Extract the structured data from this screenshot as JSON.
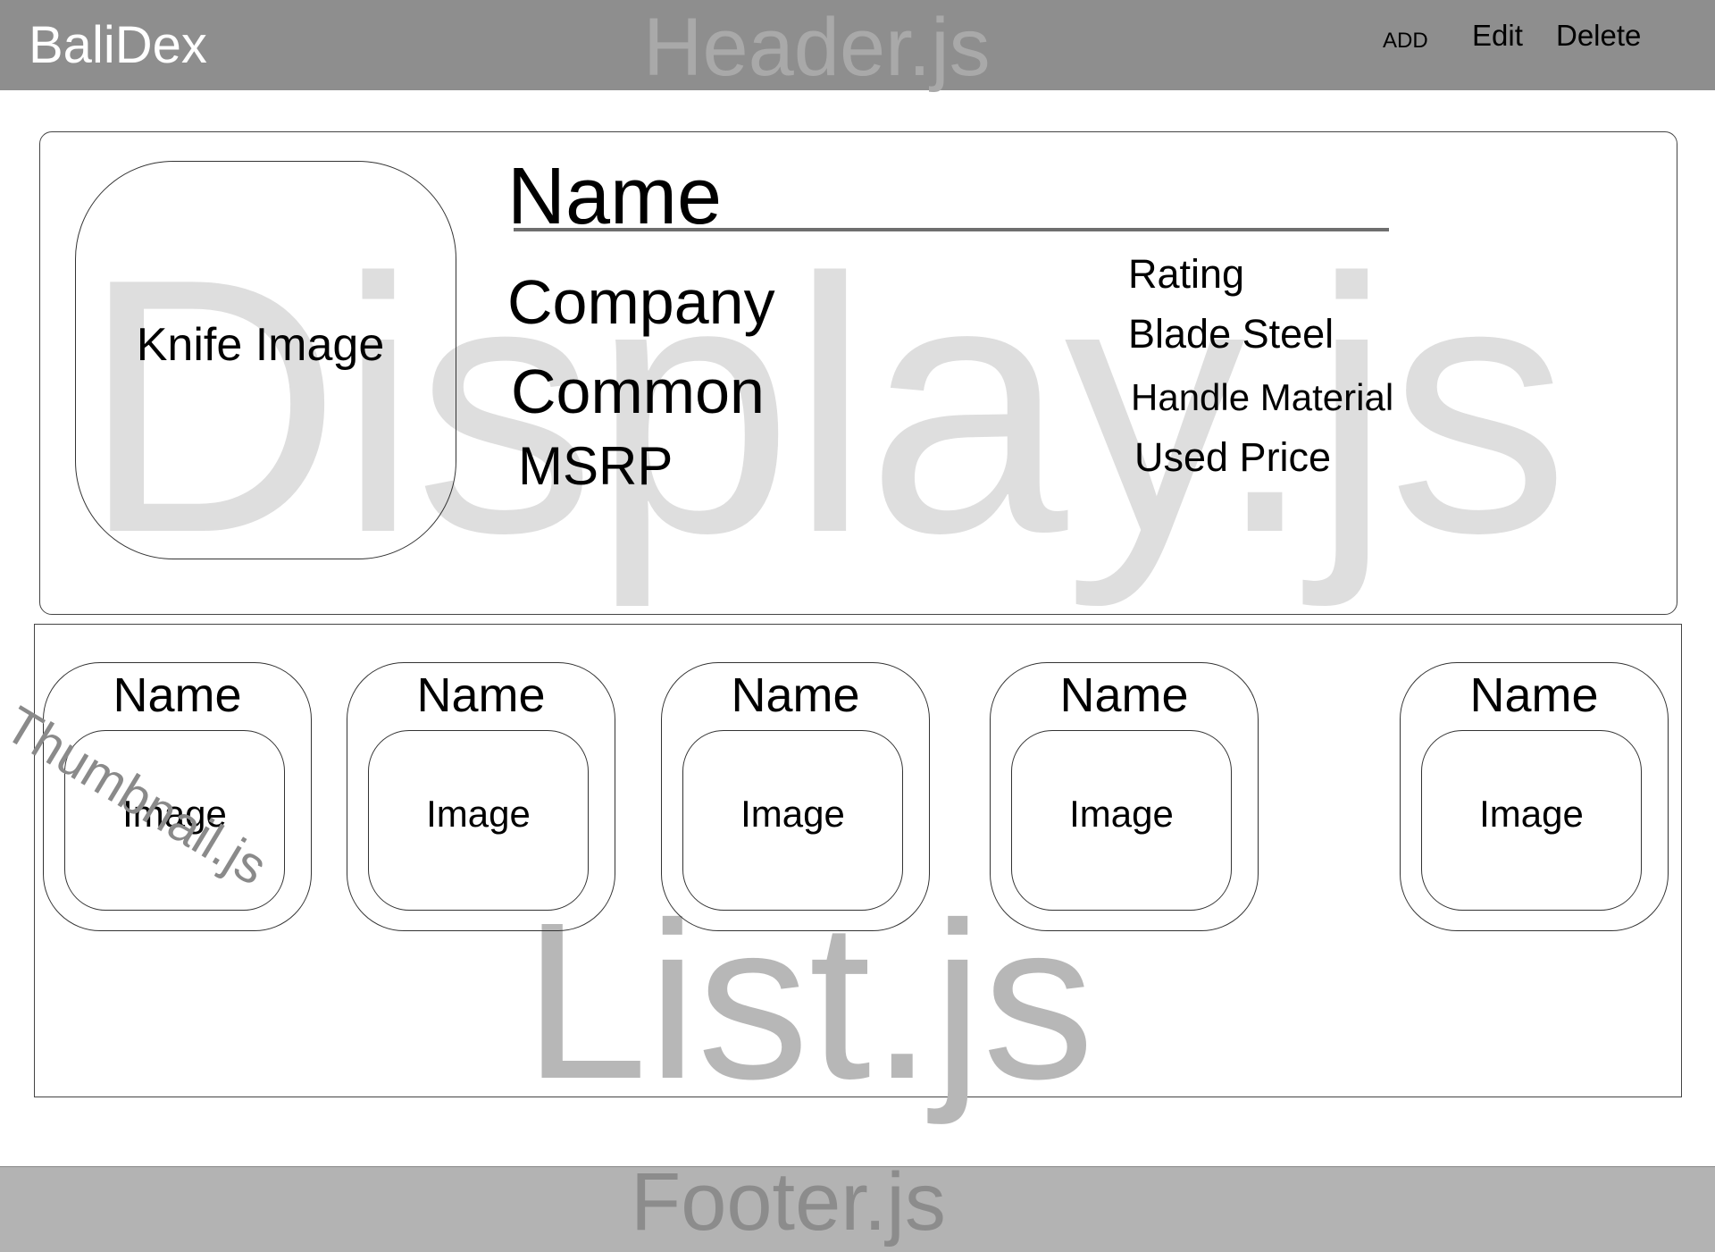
{
  "header": {
    "brand": "BaliDex",
    "watermark": "Header.js",
    "nav": {
      "add": "ADD",
      "edit": "Edit",
      "delete": "Delete"
    }
  },
  "display": {
    "watermark": "Display.js",
    "image_label": "Knife Image",
    "name": "Name",
    "left_fields": {
      "company": "Company",
      "common": "Common",
      "msrp": "MSRP"
    },
    "right_fields": {
      "rating": "Rating",
      "blade_steel": "Blade Steel",
      "handle_material": "Handle Material",
      "used_price": "Used Price"
    }
  },
  "list": {
    "watermark": "List.js",
    "thumbnail_watermark": "Thumbnail.js",
    "thumbnails": [
      {
        "name": "Name",
        "image_label": "Image"
      },
      {
        "name": "Name",
        "image_label": "Image"
      },
      {
        "name": "Name",
        "image_label": "Image"
      },
      {
        "name": "Name",
        "image_label": "Image"
      },
      {
        "name": "Name",
        "image_label": "Image"
      }
    ]
  },
  "footer": {
    "watermark": "Footer.js"
  },
  "colors": {
    "header_bg": "#8e8e8e",
    "footer_bg": "#b3b3b3",
    "display_watermark": "#dedede",
    "list_watermark": "#b7b7b7"
  }
}
